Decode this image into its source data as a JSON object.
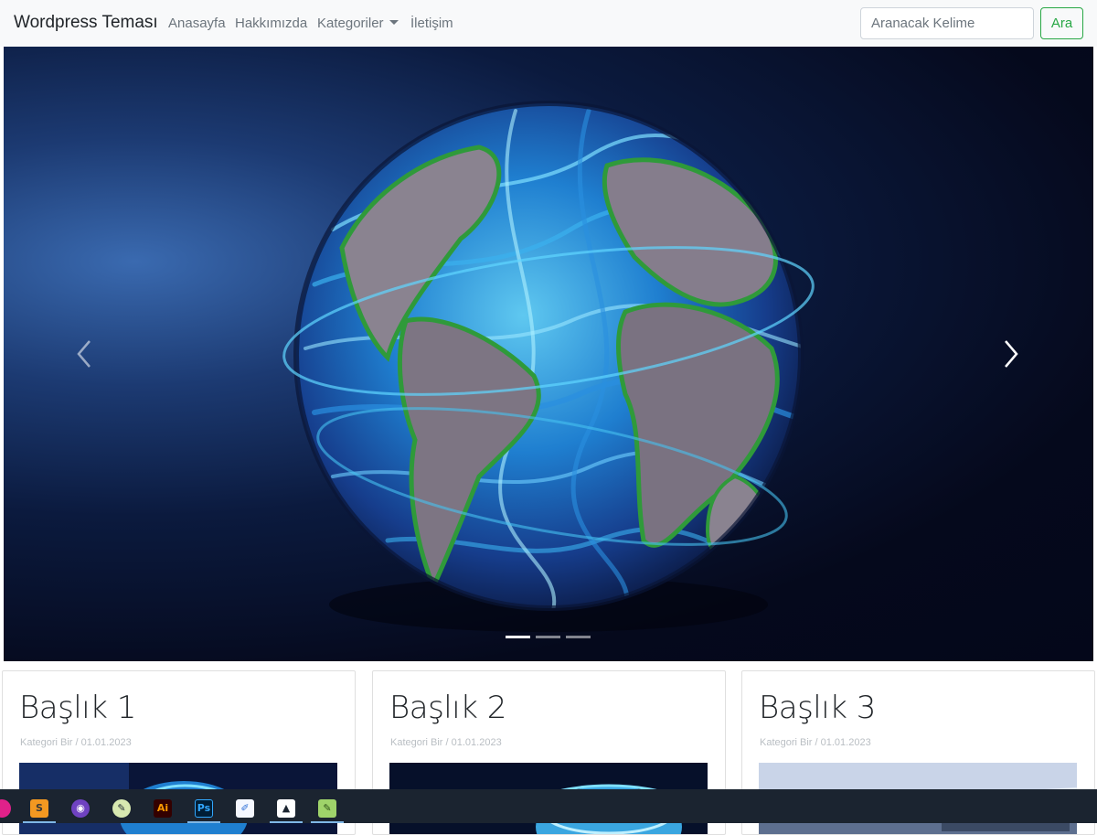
{
  "navbar": {
    "brand": "Wordpress Teması",
    "links": [
      "Anasayfa",
      "Hakkımızda",
      "Kategoriler",
      "İletişim"
    ],
    "search_placeholder": "Aranacak Kelime",
    "search_button": "Ara"
  },
  "carousel": {
    "slide_count": 3,
    "active_index": 0,
    "prev_icon": "chevron-left-icon",
    "next_icon": "chevron-right-icon"
  },
  "cards": [
    {
      "title": "Başlık 1",
      "meta": "Kategori Bir / 01.01.2023"
    },
    {
      "title": "Başlık 2",
      "meta": "Kategori Bir / 01.01.2023"
    },
    {
      "title": "Başlık 3",
      "meta": "Kategori Bir / 01.01.2023"
    }
  ],
  "taskbar": {
    "apps": [
      {
        "name": "app-icon",
        "label": ""
      },
      {
        "name": "sublime-text-icon",
        "label": ""
      },
      {
        "name": "github-desktop-icon",
        "label": ""
      },
      {
        "name": "inkscape-icon",
        "label": ""
      },
      {
        "name": "illustrator-icon",
        "label": "Ai"
      },
      {
        "name": "photoshop-icon",
        "label": "Ps"
      },
      {
        "name": "notepad-icon",
        "label": ""
      },
      {
        "name": "photos-icon",
        "label": ""
      },
      {
        "name": "notepad-plus-plus-icon",
        "label": ""
      }
    ]
  },
  "colors": {
    "accent_green": "#28a745",
    "navbar_bg": "#f8f9fa",
    "taskbar_bg": "#1b2430"
  }
}
